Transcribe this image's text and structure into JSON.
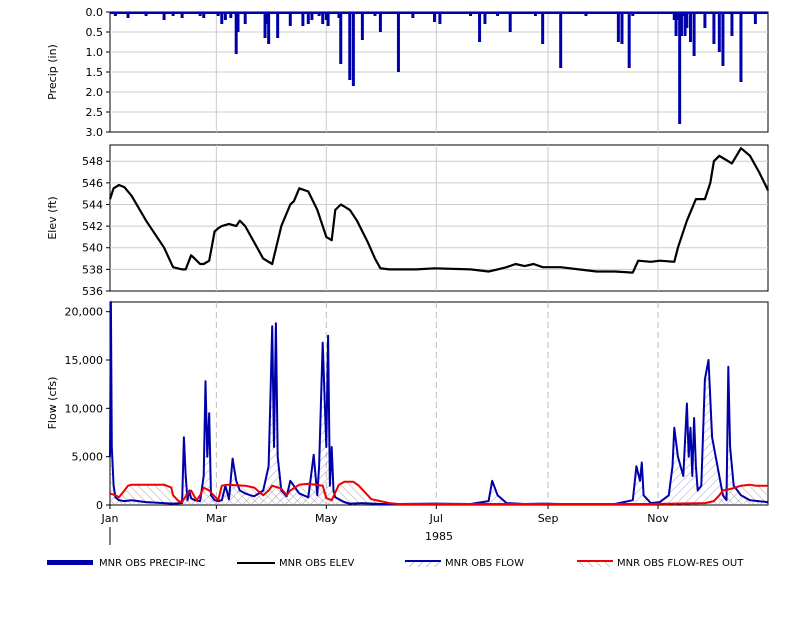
{
  "chart_data": {
    "type": "multi-panel time series",
    "year_label": "1985",
    "x_month_ticks": [
      "Jan",
      "Mar",
      "May",
      "Jul",
      "Sep",
      "Nov"
    ],
    "x_range_days": [
      0,
      365
    ],
    "panels": [
      {
        "id": "precip",
        "ylabel": "Precip (in)",
        "ylim": [
          0,
          3.0
        ],
        "y_inverted": true,
        "yticks": [
          "0.0",
          "0.5",
          "1.0",
          "1.5",
          "2.0",
          "2.5",
          "3.0"
        ],
        "ytick_values": [
          0,
          0.5,
          1.0,
          1.5,
          2.0,
          2.5,
          3.0
        ],
        "series": [
          {
            "name": "MNR OBS PRECIP-INC",
            "color": "#0000aa",
            "type": "bar",
            "x_day": [
              3,
              6,
              10,
              15,
              20,
              25,
              30,
              35,
              37,
              40,
              42,
              50,
              52,
              56,
              60,
              62,
              64,
              67,
              70,
              71,
              75,
              86,
              87,
              88,
              93,
              100,
              107,
              110,
              112,
              116,
              118,
              120,
              121,
              127,
              128,
              133,
              135,
              140,
              147,
              150,
              160,
              168,
              180,
              183,
              190,
              200,
              205,
              208,
              215,
              222,
              236,
              240,
              250,
              264,
              282,
              284,
              286,
              288,
              290,
              300,
              312,
              313,
              314,
              315,
              316,
              317,
              318,
              319,
              320,
              322,
              324,
              330,
              335,
              338,
              340,
              345,
              350,
              358
            ],
            "values": [
              0.1,
              0.05,
              0.15,
              0.05,
              0.1,
              0.05,
              0.2,
              0.1,
              0.05,
              0.15,
              0.05,
              0.1,
              0.15,
              0.05,
              0.1,
              0.3,
              0.2,
              0.15,
              1.05,
              0.5,
              0.3,
              0.65,
              0.3,
              0.8,
              0.65,
              0.35,
              0.35,
              0.3,
              0.2,
              0.1,
              0.3,
              0.2,
              0.35,
              0.15,
              1.3,
              1.7,
              1.85,
              0.7,
              0.1,
              0.5,
              1.5,
              0.15,
              0.25,
              0.3,
              0.05,
              0.1,
              0.75,
              0.3,
              0.1,
              0.5,
              0.1,
              0.8,
              1.4,
              0.1,
              0.75,
              0.8,
              0.05,
              1.4,
              0.1,
              0.05,
              0.05,
              0.2,
              0.6,
              0.2,
              2.8,
              0.6,
              0.1,
              0.6,
              0.4,
              0.75,
              1.1,
              0.4,
              0.8,
              1.0,
              1.35,
              0.6,
              1.75,
              0.3
            ]
          }
        ]
      },
      {
        "id": "elev",
        "ylabel": "Elev (ft)",
        "ylim": [
          536,
          549.5
        ],
        "yticks": [
          "536",
          "538",
          "540",
          "542",
          "544",
          "546",
          "548"
        ],
        "ytick_values": [
          536,
          538,
          540,
          542,
          544,
          546,
          548
        ],
        "series": [
          {
            "name": "MNR OBS ELEV",
            "color": "#000000",
            "type": "line",
            "x_day": [
              0,
              2,
              5,
              8,
              12,
              20,
              30,
              35,
              40,
              42,
              45,
              47,
              50,
              52,
              55,
              58,
              60,
              62,
              66,
              70,
              72,
              75,
              80,
              85,
              90,
              95,
              100,
              102,
              105,
              110,
              115,
              120,
              123,
              125,
              128,
              130,
              133,
              137,
              140,
              143,
              147,
              150,
              155,
              160,
              165,
              170,
              180,
              200,
              210,
              215,
              220,
              225,
              230,
              235,
              240,
              250,
              260,
              270,
              280,
              290,
              293,
              300,
              305,
              313,
              315,
              320,
              325,
              330,
              333,
              335,
              338,
              340,
              345,
              350,
              355,
              360,
              363,
              365
            ],
            "values": [
              544.5,
              545.5,
              545.8,
              545.6,
              544.8,
              542.5,
              540.0,
              538.2,
              538.0,
              538.0,
              539.3,
              539.0,
              538.5,
              538.5,
              538.8,
              541.5,
              541.8,
              542.0,
              542.2,
              542.0,
              542.5,
              542.0,
              540.5,
              539.0,
              538.5,
              542.0,
              544.0,
              544.3,
              545.5,
              545.2,
              543.5,
              541.0,
              540.7,
              543.5,
              544.0,
              543.8,
              543.5,
              542.5,
              541.5,
              540.5,
              539.0,
              538.1,
              538.0,
              538.0,
              538.0,
              538.0,
              538.1,
              538.0,
              537.8,
              538.0,
              538.2,
              538.5,
              538.3,
              538.5,
              538.2,
              538.2,
              538.0,
              537.8,
              537.8,
              537.7,
              538.8,
              538.7,
              538.8,
              538.7,
              540.0,
              542.5,
              544.5,
              544.5,
              546.0,
              548.0,
              548.5,
              548.3,
              547.8,
              549.2,
              548.5,
              547.0,
              546.0,
              545.3
            ]
          }
        ]
      },
      {
        "id": "flow",
        "ylabel": "Flow (cfs)",
        "ylim": [
          0,
          21000
        ],
        "yticks": [
          "0",
          "5,000",
          "10,000",
          "15,000",
          "20,000"
        ],
        "ytick_values": [
          0,
          5000,
          10000,
          15000,
          20000
        ],
        "series": [
          {
            "name": "MNR OBS FLOW",
            "color": "#0000aa",
            "type": "line",
            "x_day": [
              0,
              0.5,
              1,
              2,
              3,
              5,
              8,
              12,
              20,
              30,
              35,
              40,
              41,
              42,
              43,
              44,
              45,
              47,
              50,
              52,
              53,
              54,
              55,
              56,
              58,
              60,
              62,
              64,
              66,
              68,
              70,
              72,
              75,
              78,
              80,
              85,
              88,
              89,
              90,
              91,
              92,
              93,
              95,
              98,
              100,
              105,
              110,
              113,
              115,
              116,
              118,
              120,
              121,
              122,
              123,
              124,
              125,
              128,
              130,
              133,
              140,
              150,
              160,
              180,
              200,
              210,
              212,
              215,
              220,
              230,
              240,
              250,
              260,
              280,
              290,
              292,
              294,
              295,
              296,
              300,
              305,
              310,
              312,
              313,
              315,
              318,
              320,
              321,
              322,
              323,
              324,
              325,
              326,
              328,
              330,
              332,
              334,
              336,
              340,
              342,
              343,
              344,
              346,
              348,
              350,
              355,
              365
            ],
            "values": [
              5000,
              21000,
              6000,
              2000,
              800,
              500,
              400,
              500,
              300,
              200,
              150,
              200,
              7000,
              3000,
              500,
              1500,
              700,
              500,
              400,
              3000,
              12800,
              5000,
              9500,
              1000,
              500,
              400,
              500,
              2000,
              600,
              4800,
              2500,
              1500,
              1200,
              1000,
              900,
              1500,
              4000,
              11000,
              18500,
              6000,
              18800,
              5000,
              1500,
              900,
              2500,
              1200,
              800,
              5200,
              1000,
              4000,
              16800,
              6000,
              17500,
              2000,
              6000,
              1500,
              800,
              500,
              300,
              150,
              200,
              100,
              100,
              150,
              100,
              400,
              2500,
              1000,
              200,
              100,
              150,
              100,
              100,
              100,
              500,
              4000,
              2500,
              4400,
              1000,
              200,
              300,
              1000,
              4000,
              8000,
              5000,
              3000,
              10500,
              5000,
              8000,
              3000,
              9000,
              4000,
              1500,
              2000,
              13000,
              15000,
              7000,
              5000,
              1000,
              500,
              14300,
              6000,
              2000,
              1500,
              1000,
              500,
              300
            ]
          },
          {
            "name": "MNR OBS FLOW-RES OUT",
            "color": "#ee0000",
            "type": "line",
            "x_day": [
              0,
              3,
              5,
              8,
              10,
              12,
              30,
              34,
              35,
              38,
              40,
              43,
              45,
              48,
              50,
              52,
              55,
              60,
              62,
              65,
              75,
              80,
              85,
              88,
              90,
              95,
              98,
              100,
              105,
              110,
              118,
              120,
              123,
              127,
              130,
              135,
              138,
              142,
              145,
              150,
              155,
              160,
              200,
              300,
              330,
              335,
              338,
              340,
              345,
              350,
              355,
              358,
              365
            ],
            "values": [
              1200,
              1000,
              800,
              1500,
              2000,
              2100,
              2100,
              1800,
              1000,
              400,
              300,
              1200,
              1500,
              500,
              1000,
              1800,
              1500,
              500,
              2000,
              2100,
              2000,
              1800,
              1000,
              1500,
              2000,
              1700,
              1000,
              1500,
              2100,
              2200,
              2000,
              700,
              500,
              2100,
              2400,
              2400,
              2000,
              1200,
              600,
              400,
              200,
              100,
              100,
              100,
              200,
              400,
              1000,
              1500,
              1700,
              2000,
              2100,
              2000,
              2000
            ]
          }
        ]
      }
    ]
  },
  "legend": [
    {
      "label": "MNR OBS PRECIP-INC",
      "color": "#0000aa",
      "style": "thick"
    },
    {
      "label": "MNR OBS ELEV",
      "color": "#000000",
      "style": "line"
    },
    {
      "label": "MNR OBS FLOW",
      "color": "#0000aa",
      "style": "hatched"
    },
    {
      "label": "MNR OBS FLOW-RES OUT",
      "color": "#ee0000",
      "style": "hatched"
    }
  ]
}
